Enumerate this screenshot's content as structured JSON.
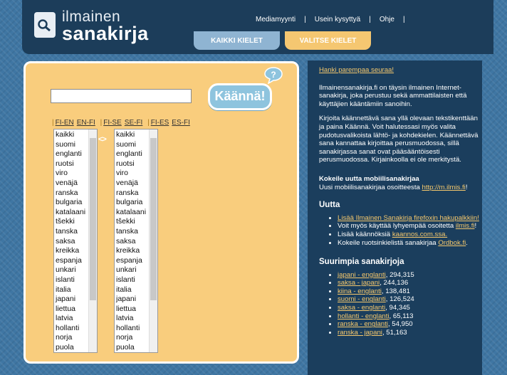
{
  "brand": {
    "line1": "ilmainen",
    "line2": "sanakirja"
  },
  "topnav": [
    {
      "label": "Mediamyynti"
    },
    {
      "label": "Usein kysyttyä"
    },
    {
      "label": "Ohje"
    }
  ],
  "tabs": {
    "all": "KAIKKI KIELET",
    "select": "VALITSE KIELET"
  },
  "search": {
    "value": "",
    "placeholder": ""
  },
  "translate_button": "Käännä!",
  "help_bubble": "?",
  "lang_links": [
    "FI-EN",
    "EN-FI",
    "FI-SE",
    "SE-FI",
    "FI-ES",
    "ES-FI"
  ],
  "swap_symbol": "<>",
  "languages": [
    "kaikki",
    "suomi",
    "englanti",
    "ruotsi",
    "viro",
    "venäjä",
    "ranska",
    "bulgaria",
    "katalaani",
    "tšekki",
    "tanska",
    "saksa",
    "kreikka",
    "espanja",
    "unkari",
    "islanti",
    "italia",
    "japani",
    "liettua",
    "latvia",
    "hollanti",
    "norja",
    "puola"
  ],
  "sidebar": {
    "follow_link": "Hanki parempaa seuraa!",
    "intro": "Ilmainensanakirja.fi on täysin ilmainen Internet-sanakirja, joka perustuu sekä ammattilaisten että käyttäjien kääntämiin sanoihin.",
    "instructions": "Kirjoita käännettävä sana yllä olevaan tekstikenttään ja paina Käännä. Voit halutessasi myös valita pudotusvalikoista lähtö- ja kohdekielen. Käännettävä sana kannattaa kirjoittaa perusmuodossa, sillä sanakirjassa sanat ovat pääsääntöisesti perusmuodossa. Kirjainkoolla ei ole merkitystä.",
    "mobile_title": "Kokeile uutta mobiilisanakirjaa",
    "mobile_text": "Uusi mobiilisanakirjaa osoitteesta",
    "mobile_link": "http://m.ilmis.fi",
    "mobile_end": "!",
    "news_title": "Uutta",
    "news": [
      {
        "pre": "",
        "link": "Lisää Ilmainen Sanakirja firefoxin hakupalkkiin!",
        "post": ""
      },
      {
        "pre": "Voit myös käyttää lyhyempää osoitetta ",
        "link": "ilmis.fi",
        "post": "!"
      },
      {
        "pre": "Lisää käännöksiä ",
        "link": "kaannos.com.ssa.",
        "post": ""
      },
      {
        "pre": "Kokeile ruotsinkielistä sanakirjaa ",
        "link": "Ordbok.fi",
        "post": "."
      }
    ],
    "top_title": "Suurimpia sanakirjoja",
    "top": [
      {
        "link": "japani - englanti",
        "count": ", 294,315"
      },
      {
        "link": "saksa - japani",
        "count": ", 244,136"
      },
      {
        "link": "kiina - englanti",
        "count": ", 138,481"
      },
      {
        "link": "suomi - englanti",
        "count": ", 126,524"
      },
      {
        "link": "saksa - englanti",
        "count": ", 94,345"
      },
      {
        "link": "hollanti - englanti",
        "count": ", 65,113"
      },
      {
        "link": "ranska - englanti",
        "count": ", 54,950"
      },
      {
        "link": "ranska - japani",
        "count": ", 51,163"
      }
    ]
  }
}
